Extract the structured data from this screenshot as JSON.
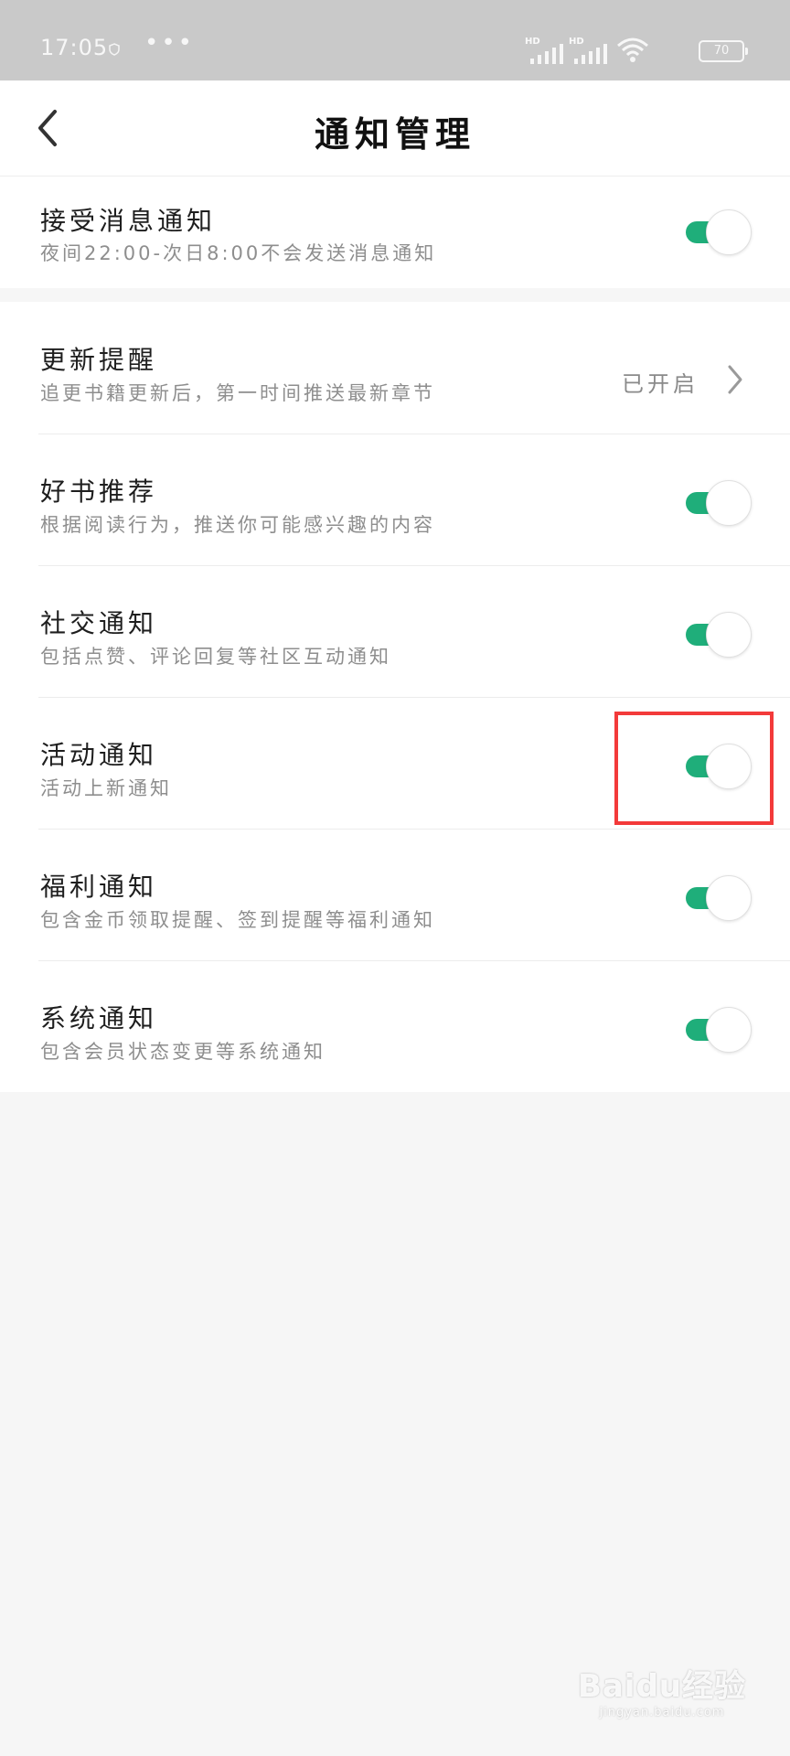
{
  "status_bar": {
    "time": "17:05",
    "dots": "•••",
    "signal1_label": "HD",
    "signal2_label": "HD",
    "battery": "70"
  },
  "header": {
    "title": "通知管理"
  },
  "sections": [
    {
      "rows": [
        {
          "title": "接受消息通知",
          "subtitle": "夜间22:00-次日8:00不会发送消息通知",
          "control": "toggle",
          "enabled": true
        }
      ]
    },
    {
      "rows": [
        {
          "title": "更新提醒",
          "subtitle": "追更书籍更新后，第一时间推送最新章节",
          "control": "nav",
          "value": "已开启"
        },
        {
          "title": "好书推荐",
          "subtitle": "根据阅读行为，推送你可能感兴趣的内容",
          "control": "toggle",
          "enabled": true
        },
        {
          "title": "社交通知",
          "subtitle": "包括点赞、评论回复等社区互动通知",
          "control": "toggle",
          "enabled": true
        },
        {
          "title": "活动通知",
          "subtitle": "活动上新通知",
          "control": "toggle",
          "enabled": true
        },
        {
          "title": "福利通知",
          "subtitle": "包含金币领取提醒、签到提醒等福利通知",
          "control": "toggle",
          "enabled": true
        },
        {
          "title": "系统通知",
          "subtitle": "包含会员状态变更等系统通知",
          "control": "toggle",
          "enabled": true
        }
      ]
    }
  ],
  "colors": {
    "toggle_on": "#1fae7a",
    "highlight": "#f33a3a",
    "background": "#f6f6f6"
  },
  "watermark": {
    "main": "Baidu经验",
    "sub": "jingyan.baidu.com"
  }
}
